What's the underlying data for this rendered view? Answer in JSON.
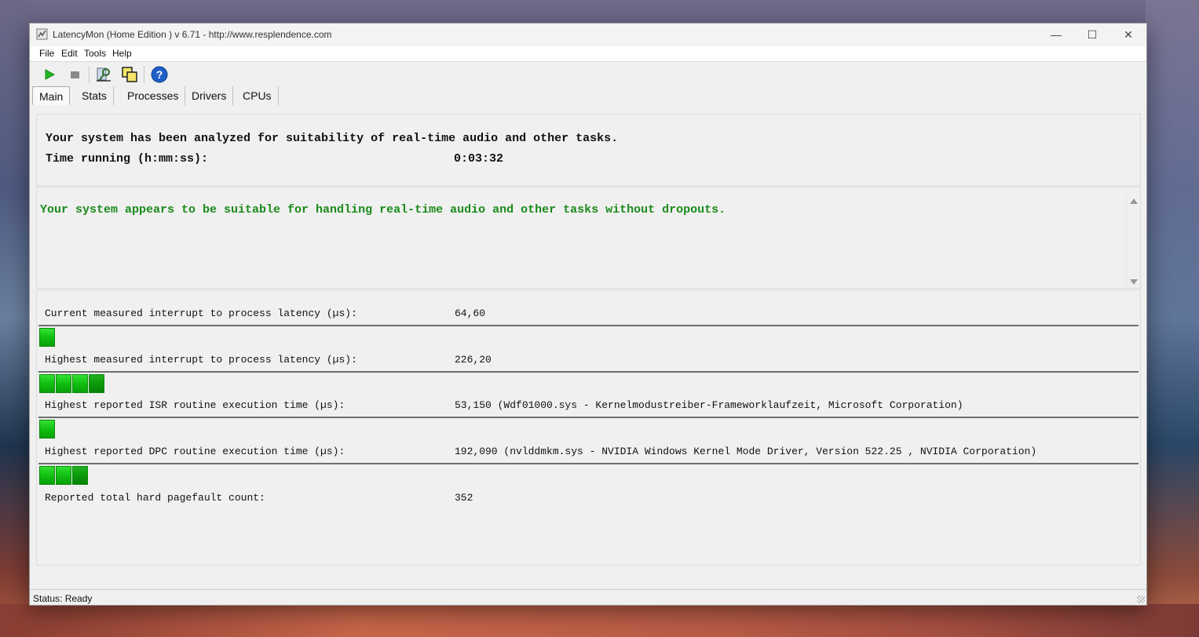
{
  "window": {
    "title": "LatencyMon  (Home Edition )  v 6.71 - http://www.resplendence.com",
    "minimize_glyph": "—",
    "maximize_glyph": "☐",
    "close_glyph": "✕"
  },
  "menu": {
    "file": "File",
    "edit": "Edit",
    "tools": "Tools",
    "help": "Help"
  },
  "toolbar": {
    "icons": [
      "play-icon",
      "stop-icon",
      "analyze-icon",
      "copy-icon",
      "help-icon"
    ],
    "colors": {
      "play": "#22b522",
      "stop": "#808080",
      "help": "#1e5fc8"
    }
  },
  "tabs": {
    "main": "Main",
    "stats": "Stats",
    "processes": "Processes",
    "drivers": "Drivers",
    "cpus": "CPUs"
  },
  "summary": {
    "analyzed_text": "Your system has been analyzed for suitability of real-time audio and other tasks.",
    "time_label": "Time running (h:mm:ss):",
    "time_value": "0:03:32"
  },
  "verdict": {
    "text": "Your system appears to be suitable for handling real-time audio and other tasks without dropouts.",
    "color": "#1a8a1a"
  },
  "metrics": [
    {
      "label": "Current measured interrupt to process latency (µs):",
      "value": "64,60",
      "meter_segments": 1
    },
    {
      "label": "Highest measured interrupt to process latency (µs):",
      "value": "226,20",
      "meter_segments": 4
    },
    {
      "label": "Highest reported ISR routine execution time (µs):",
      "value": "53,150   (Wdf01000.sys - Kernelmodustreiber-Frameworklaufzeit, Microsoft Corporation)",
      "meter_segments": 1
    },
    {
      "label": "Highest reported DPC routine execution time (µs):",
      "value": "192,090   (nvlddmkm.sys - NVIDIA Windows Kernel Mode Driver, Version 522.25 , NVIDIA Corporation)",
      "meter_segments": 3
    },
    {
      "label": "Reported total hard pagefault count:",
      "value": "352"
    }
  ],
  "status": {
    "text": "Status: Ready"
  }
}
